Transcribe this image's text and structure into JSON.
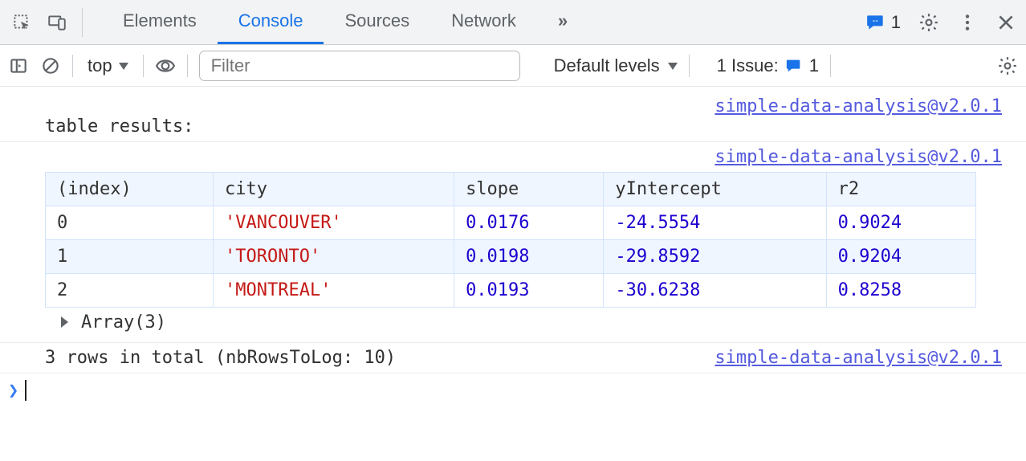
{
  "tabs": {
    "items": [
      "Elements",
      "Console",
      "Sources",
      "Network"
    ],
    "active_index": 1,
    "overflow_label": "»"
  },
  "top_right": {
    "issues_badge_count": "1"
  },
  "toolbar": {
    "context_label": "top",
    "filter_placeholder": "Filter",
    "filter_value": "",
    "levels_label": "Default levels",
    "issues_label": "1 Issue:",
    "issues_count": "1"
  },
  "console": {
    "source_link": "simple-data-analysis@v2.0.1",
    "message_label": "table results:",
    "table": {
      "columns": [
        "(index)",
        "city",
        "slope",
        "yIntercept",
        "r2"
      ],
      "rows": [
        {
          "index": "0",
          "city": "'VANCOUVER'",
          "slope": "0.0176",
          "yIntercept": "-24.5554",
          "r2": "0.9024"
        },
        {
          "index": "1",
          "city": "'TORONTO'",
          "slope": "0.0198",
          "yIntercept": "-29.8592",
          "r2": "0.9204"
        },
        {
          "index": "2",
          "city": "'MONTREAL'",
          "slope": "0.0193",
          "yIntercept": "-30.6238",
          "r2": "0.8258"
        }
      ]
    },
    "expander_label": "Array(3)",
    "footer_text": "3 rows in total (nbRowsToLog: 10)"
  }
}
